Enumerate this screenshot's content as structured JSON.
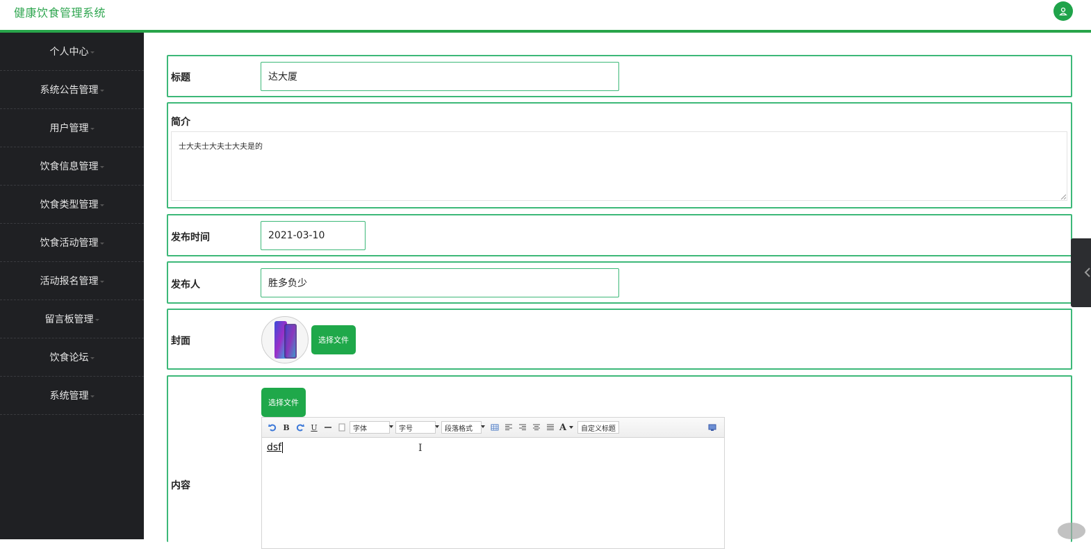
{
  "app": {
    "title": "健康饮食管理系统"
  },
  "header": {
    "avatar_icon": "user-icon"
  },
  "sidebar": {
    "items": [
      {
        "label": "个人中心"
      },
      {
        "label": "系统公告管理"
      },
      {
        "label": "用户管理"
      },
      {
        "label": "饮食信息管理"
      },
      {
        "label": "饮食类型管理"
      },
      {
        "label": "饮食活动管理"
      },
      {
        "label": "活动报名管理"
      },
      {
        "label": "留言板管理"
      },
      {
        "label": "饮食论坛"
      },
      {
        "label": "系统管理"
      }
    ]
  },
  "form": {
    "title": {
      "label": "标题",
      "value": "达大厦"
    },
    "intro": {
      "label": "简介",
      "value": "士大夫士大夫士大夫是的"
    },
    "publish_time": {
      "label": "发布时间",
      "value": "2021-03-10"
    },
    "publisher": {
      "label": "发布人",
      "value": "胜多负少"
    },
    "cover": {
      "label": "封面",
      "button": "选择文件"
    },
    "content": {
      "label": "内容",
      "button": "选择文件",
      "toolbar": {
        "bold": "B",
        "underline": "U",
        "font": "字体",
        "size": "字号",
        "paragraph": "段落格式",
        "color": "A",
        "custom_title": "自定义标题"
      },
      "value": "dsf"
    }
  },
  "colors": {
    "accent": "#28a44a",
    "sidebar_bg": "#1f2023",
    "border": "#3cb878"
  }
}
